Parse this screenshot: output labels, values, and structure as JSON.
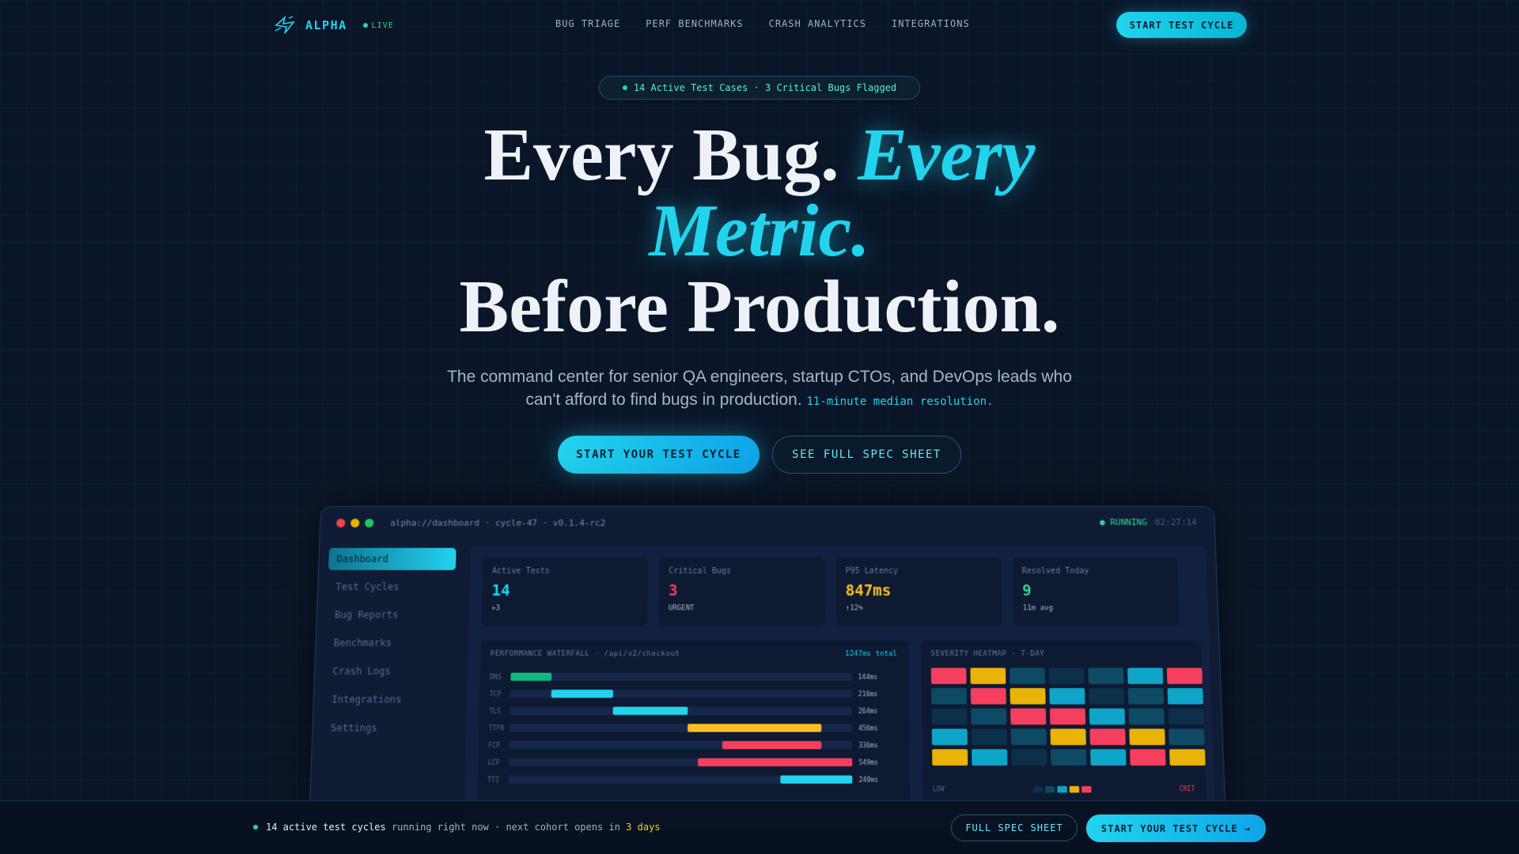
{
  "nav": {
    "brand": "ALPHA",
    "live": "LIVE",
    "links": [
      "BUG TRIAGE",
      "PERF BENCHMARKS",
      "CRASH ANALYTICS",
      "INTEGRATIONS"
    ],
    "cta": "START TEST CYCLE",
    "logo_icon": "spark-icon"
  },
  "badge": "14 Active Test Cases · 3 Critical Bugs Flagged",
  "hero": {
    "line1_plain": "Every Bug. ",
    "line1_accent": "Every",
    "line2_accent": "Metric.",
    "line3": "Before Production."
  },
  "subtitle": {
    "text": "The command center for senior QA engineers, startup CTOs, and DevOps leads who can't afford to find bugs in production.",
    "highlight": "11-minute median resolution."
  },
  "buttons": {
    "primary": "START YOUR TEST CYCLE",
    "secondary": "SEE FULL SPEC SHEET"
  },
  "dashboard": {
    "url": "alpha://dashboard · cycle-47 · v0.1.4-rc2",
    "status": "RUNNING",
    "timer": "02:27:14",
    "sidebar": [
      "Dashboard",
      "Test Cycles",
      "Bug Reports",
      "Benchmarks",
      "Crash Logs",
      "Integrations",
      "Settings"
    ],
    "stats": [
      {
        "label": "Active Tests",
        "value": "14",
        "note": "+3",
        "color": "#22d3ee"
      },
      {
        "label": "Critical Bugs",
        "value": "3",
        "note": "URGENT",
        "color": "#f43f5e"
      },
      {
        "label": "P95 Latency",
        "value": "847ms",
        "note": "↑12%",
        "color": "#fbbf24"
      },
      {
        "label": "Resolved Today",
        "value": "9",
        "note": "11m avg",
        "color": "#34d399"
      }
    ],
    "waterfall": {
      "title": "PERFORMANCE WATERFALL · /api/v2/checkout",
      "total": "1247ms total",
      "rows": [
        {
          "label": "DNS",
          "time": "144ms",
          "start": 0.0,
          "end": 0.12,
          "color": "#10b981"
        },
        {
          "label": "TCP",
          "time": "216ms",
          "start": 0.12,
          "end": 0.3,
          "color": "#22d3ee"
        },
        {
          "label": "TLS",
          "time": "264ms",
          "start": 0.3,
          "end": 0.52,
          "color": "#22d3ee"
        },
        {
          "label": "TTFB",
          "time": "456ms",
          "start": 0.52,
          "end": 0.91,
          "color": "#fbbf24"
        },
        {
          "label": "FCP",
          "time": "336ms",
          "start": 0.62,
          "end": 0.91,
          "color": "#f43f5e"
        },
        {
          "label": "LCP",
          "time": "549ms",
          "start": 0.55,
          "end": 1.0,
          "color": "#f43f5e"
        },
        {
          "label": "TTI",
          "time": "240ms",
          "start": 0.79,
          "end": 1.0,
          "color": "#22d3ee"
        }
      ]
    },
    "heatmap": {
      "title": "SEVERITY HEATMAP · 7-DAY",
      "low": "LOW",
      "crit": "CRIT",
      "cells": [
        "#f43f5e",
        "#eab308",
        "#0e4a63",
        "#0c2f4a",
        "#0e4a63",
        "#0ea5c9",
        "#f43f5e",
        "#0e4a63",
        "#f43f5e",
        "#eab308",
        "#0ea5c9",
        "#0c2f4a",
        "#0e4a63",
        "#0ea5c9",
        "#0c2f4a",
        "#0e4a63",
        "#f43f5e",
        "#f43f5e",
        "#0ea5c9",
        "#0e4a63",
        "#0c2f4a",
        "#0ea5c9",
        "#0c2f4a",
        "#0e4a63",
        "#eab308",
        "#f43f5e",
        "#eab308",
        "#0e4a63",
        "#eab308",
        "#0ea5c9",
        "#0c2f4a",
        "#0e4a63",
        "#0ea5c9",
        "#f43f5e",
        "#eab308"
      ],
      "legend": [
        "#0c2f4a",
        "#0e4a63",
        "#0ea5c9",
        "#eab308",
        "#f43f5e"
      ]
    }
  },
  "bottom_bar": {
    "count_text": "14 active test cycles",
    "middle_text": "running right now · next cohort opens in",
    "days": "3 days",
    "secondary": "FULL SPEC SHEET",
    "primary": "START YOUR TEST CYCLE →"
  }
}
